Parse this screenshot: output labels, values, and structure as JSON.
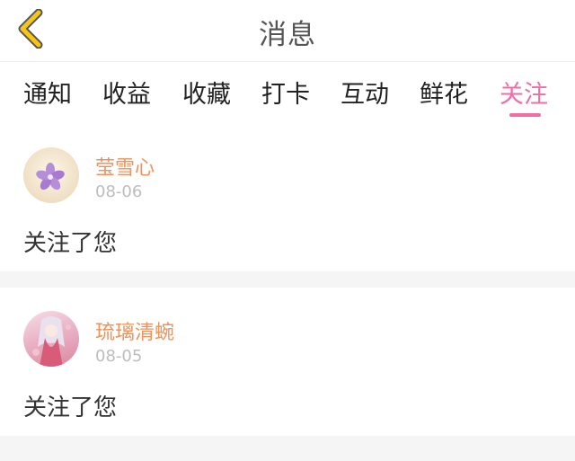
{
  "header": {
    "title": "消息"
  },
  "tabs": [
    {
      "label": "通知"
    },
    {
      "label": "收益"
    },
    {
      "label": "收藏"
    },
    {
      "label": "打卡"
    },
    {
      "label": "互动"
    },
    {
      "label": "鲜花"
    },
    {
      "label": "关注"
    }
  ],
  "active_tab": "关注",
  "messages": [
    {
      "name": "莹雪心",
      "date": "08-06",
      "text": "关注了您"
    },
    {
      "name": "琉璃清蜿",
      "date": "08-05",
      "text": "关注了您"
    }
  ],
  "colors": {
    "accent": "#f06ea6",
    "username": "#f0925a",
    "back_icon": "#f5c518"
  }
}
